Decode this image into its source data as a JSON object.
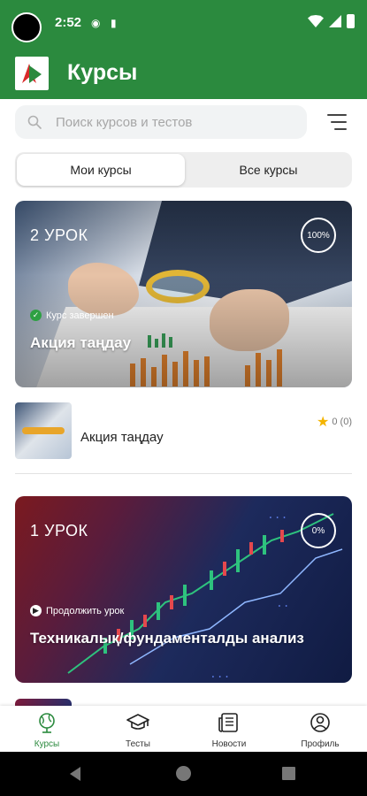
{
  "status_bar": {
    "time": "2:52",
    "icons": [
      "camera-dot",
      "app-notification-icon",
      "sd-card-icon",
      "wifi-icon",
      "signal-icon",
      "battery-icon"
    ]
  },
  "app_bar": {
    "title": "Курсы",
    "logo": "app-logo"
  },
  "search": {
    "placeholder": "Поиск курсов и тестов",
    "value": ""
  },
  "tabs": [
    {
      "label": "Мои курсы",
      "active": true
    },
    {
      "label": "Все курсы",
      "active": false
    }
  ],
  "courses": [
    {
      "lessons": "2 УРОК",
      "progress": "100%",
      "status": "Курс завершен",
      "status_icon": "check-icon",
      "title": "Акция таңдау"
    },
    {
      "lessons": "1 УРОК",
      "progress": "0%",
      "status": "Продолжить урок",
      "status_icon": "play-icon",
      "title": "Техникалық/фундаменталды анализ"
    }
  ],
  "list_item": {
    "title": "Акция таңдау",
    "rating": "0 (0)"
  },
  "bottom_nav": [
    {
      "label": "Курсы",
      "icon": "globe-icon",
      "active": true
    },
    {
      "label": "Тесты",
      "icon": "graduation-cap-icon",
      "active": false
    },
    {
      "label": "Новости",
      "icon": "newspaper-icon",
      "active": false
    },
    {
      "label": "Профиль",
      "icon": "profile-icon",
      "active": false
    }
  ],
  "colors": {
    "primary": "#2b8a3e",
    "accent_star": "#f4b400",
    "complete_chip": "#2ea043",
    "background": "#ffffff"
  }
}
